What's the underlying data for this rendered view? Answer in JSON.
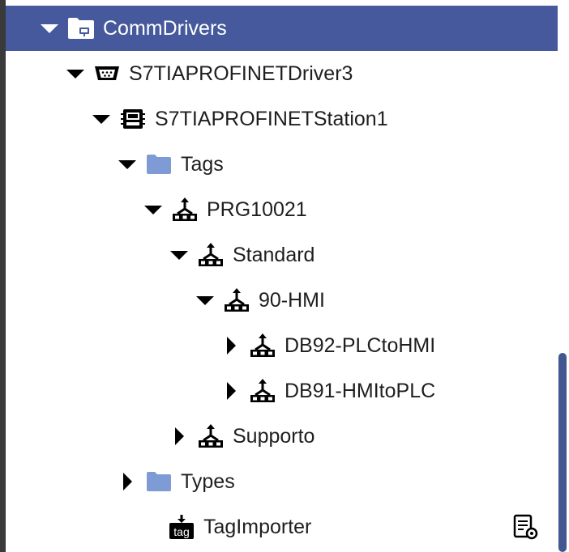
{
  "tree": {
    "items": [
      {
        "label": "CommDrivers",
        "expanded": true,
        "icon": "folder-icon",
        "selected": true
      },
      {
        "label": "S7TIAPROFINETDriver3",
        "expanded": true,
        "icon": "serial-port-icon"
      },
      {
        "label": "S7TIAPROFINETStation1",
        "expanded": true,
        "icon": "plc-station-icon"
      },
      {
        "label": "Tags",
        "expanded": true,
        "icon": "folder-icon"
      },
      {
        "label": "PRG10021",
        "expanded": true,
        "icon": "network-tree-icon"
      },
      {
        "label": "Standard",
        "expanded": true,
        "icon": "network-tree-icon"
      },
      {
        "label": "90-HMI",
        "expanded": true,
        "icon": "network-tree-icon"
      },
      {
        "label": "DB92-PLCtoHMI",
        "expanded": false,
        "icon": "network-tree-icon"
      },
      {
        "label": "DB91-HMItoPLC",
        "expanded": false,
        "icon": "network-tree-icon"
      },
      {
        "label": "Supporto",
        "expanded": false,
        "icon": "network-tree-icon"
      },
      {
        "label": "Types",
        "expanded": false,
        "icon": "folder-icon"
      },
      {
        "label": "TagImporter",
        "icon": "tag-importer-icon",
        "tag_badge": "tag",
        "trailing_icon": "document-settings-icon"
      }
    ]
  },
  "colors": {
    "selected_bg": "#46599c",
    "folder": "#7f9bd6",
    "scroll_thumb": "#43568f"
  }
}
